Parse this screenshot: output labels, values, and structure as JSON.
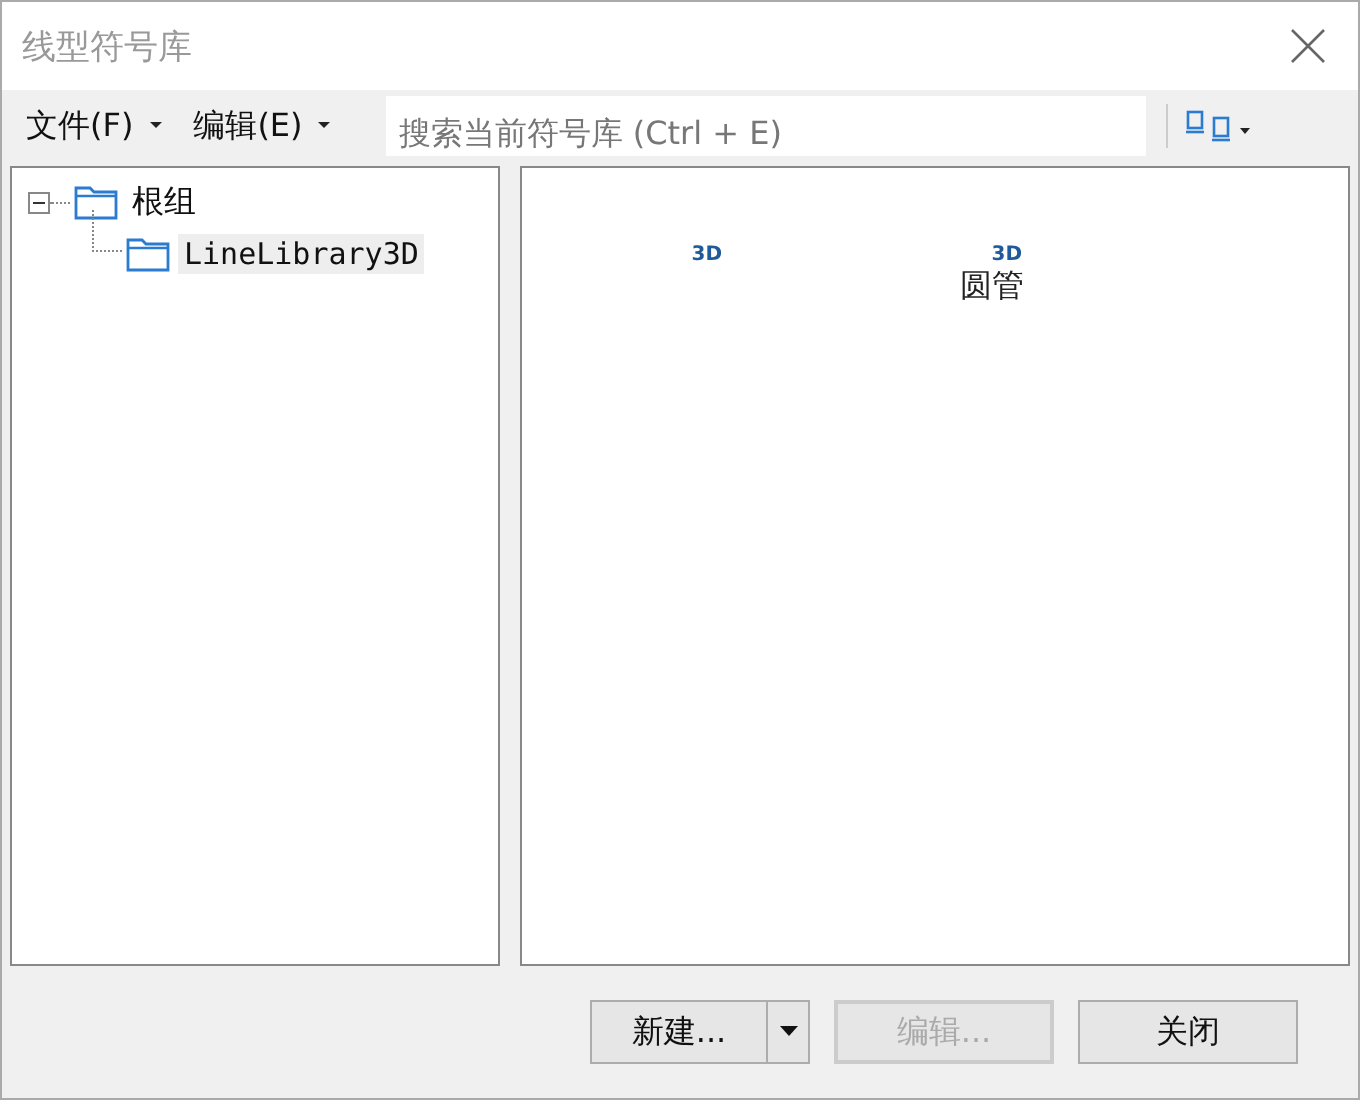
{
  "window": {
    "title": "线型符号库"
  },
  "menu": [
    {
      "label": "文件(F)"
    },
    {
      "label": "编辑(E)"
    }
  ],
  "search": {
    "placeholder": "搜索当前符号库 (Ctrl + E)"
  },
  "tree": {
    "label": "根组",
    "expanded": true,
    "children": [
      {
        "label": "LineLibrary3D",
        "selected": true
      }
    ]
  },
  "symbols": [
    {
      "badge": "3D"
    },
    {
      "badge": "3D",
      "label": "圆管"
    }
  ],
  "buttons": [
    {
      "label": "新建...",
      "kind": "split",
      "disabled": false
    },
    {
      "label": "编辑...",
      "kind": "plain",
      "disabled": true
    },
    {
      "label": "关闭",
      "kind": "plain",
      "disabled": false
    }
  ]
}
